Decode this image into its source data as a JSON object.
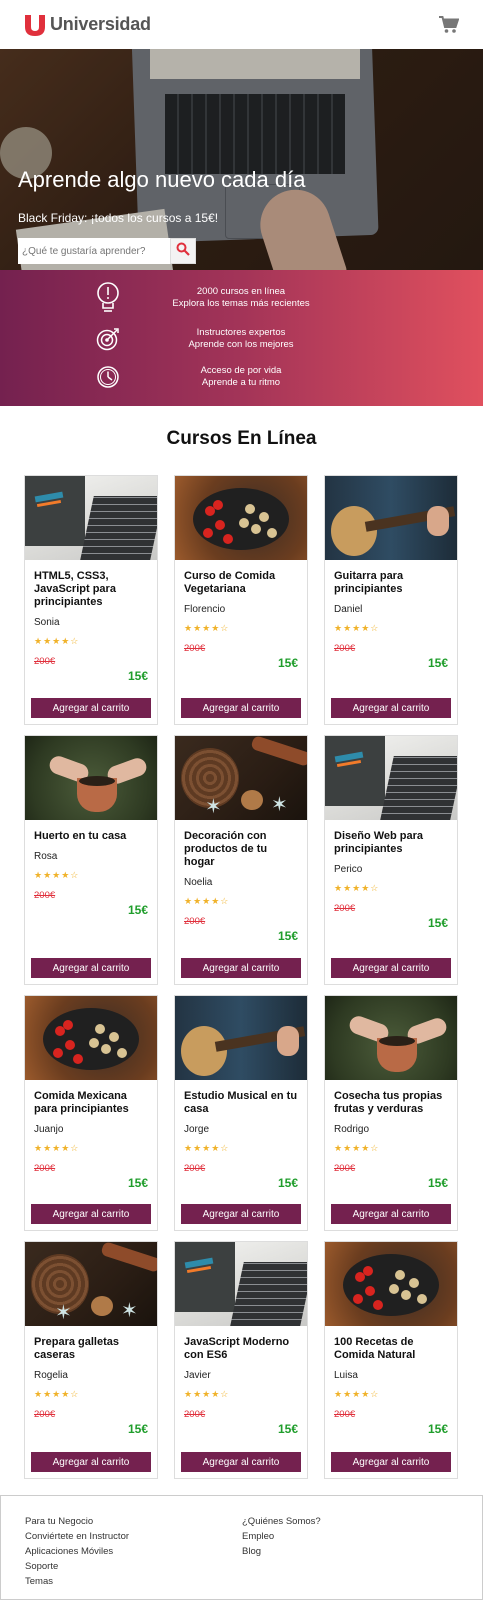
{
  "header": {
    "logo_text": "Universidad",
    "cart_icon": "cart-icon"
  },
  "hero": {
    "title": "Aprende algo nuevo cada día",
    "subtitle": "Black Friday: ¡todos los cursos a 15€!",
    "search_placeholder": "¿Qué te gustaría aprender?",
    "search_icon": "search-icon"
  },
  "features": [
    {
      "icon": "lightbulb-icon",
      "line1": "2000 cursos en línea",
      "line2": "Explora los temas más recientes"
    },
    {
      "icon": "target-icon",
      "line1": "Instructores expertos",
      "line2": "Aprende con los mejores"
    },
    {
      "icon": "clock-icon",
      "line1": "Acceso de por vida",
      "line2": "Aprende a tu ritmo"
    }
  ],
  "courses_title": "Cursos En Línea",
  "courses": [
    {
      "title": "HTML5, CSS3, JavaScript para principiantes",
      "author": "Sonia",
      "stars": "★★★★☆",
      "old_price": "200€",
      "price": "15€",
      "button": "Agregar al carrito",
      "image": "notebook"
    },
    {
      "title": "Curso de Comida Vegetariana",
      "author": "Florencio",
      "stars": "★★★★☆",
      "old_price": "200€",
      "price": "15€",
      "button": "Agregar al carrito",
      "image": "food"
    },
    {
      "title": "Guitarra para principiantes",
      "author": "Daniel",
      "stars": "★★★★☆",
      "old_price": "200€",
      "price": "15€",
      "button": "Agregar al carrito",
      "image": "guitar"
    },
    {
      "title": "Huerto en tu casa",
      "author": "Rosa",
      "stars": "★★★★☆",
      "old_price": "200€",
      "price": "15€",
      "button": "Agregar al carrito",
      "image": "garden"
    },
    {
      "title": "Decoración con productos de tu hogar",
      "author": "Noelia",
      "stars": "★★★★☆",
      "old_price": "200€",
      "price": "15€",
      "button": "Agregar al carrito",
      "image": "xmas"
    },
    {
      "title": "Diseño Web para principiantes",
      "author": "Perico",
      "stars": "★★★★☆",
      "old_price": "200€",
      "price": "15€",
      "button": "Agregar al carrito",
      "image": "notebook"
    },
    {
      "title": "Comida Mexicana para principiantes",
      "author": "Juanjo",
      "stars": "★★★★☆",
      "old_price": "200€",
      "price": "15€",
      "button": "Agregar al carrito",
      "image": "food"
    },
    {
      "title": "Estudio Musical en tu casa",
      "author": "Jorge",
      "stars": "★★★★☆",
      "old_price": "200€",
      "price": "15€",
      "button": "Agregar al carrito",
      "image": "guitar"
    },
    {
      "title": "Cosecha tus propias frutas y verduras",
      "author": "Rodrigo",
      "stars": "★★★★☆",
      "old_price": "200€",
      "price": "15€",
      "button": "Agregar al carrito",
      "image": "garden"
    },
    {
      "title": "Prepara galletas caseras",
      "author": "Rogelia",
      "stars": "★★★★☆",
      "old_price": "200€",
      "price": "15€",
      "button": "Agregar al carrito",
      "image": "xmas"
    },
    {
      "title": "JavaScript Moderno con ES6",
      "author": "Javier",
      "stars": "★★★★☆",
      "old_price": "200€",
      "price": "15€",
      "button": "Agregar al carrito",
      "image": "notebook"
    },
    {
      "title": "100 Recetas de Comida Natural",
      "author": "Luisa",
      "stars": "★★★★☆",
      "old_price": "200€",
      "price": "15€",
      "button": "Agregar al carrito",
      "image": "food"
    }
  ],
  "footer": {
    "col1": [
      "Para tu Negocio",
      "Conviértete en Instructor",
      "Aplicaciones Móviles",
      "Soporte",
      "Temas"
    ],
    "col2": [
      "¿Quiénes Somos?",
      "Empleo",
      "Blog"
    ]
  },
  "colors": {
    "brand_red": "#e0303c",
    "brand_purple": "#74214f",
    "price_green": "#1f9d2b",
    "star": "#f0b22a"
  }
}
